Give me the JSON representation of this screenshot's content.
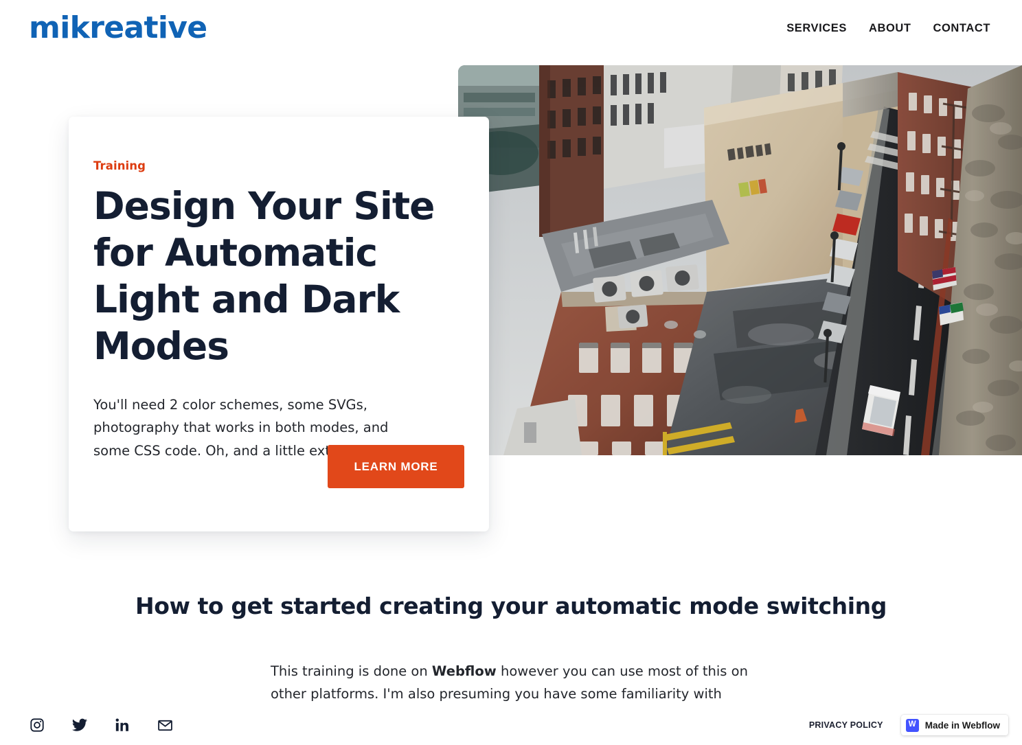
{
  "header": {
    "brand": "mikreative",
    "nav": [
      {
        "label": "SERVICES"
      },
      {
        "label": "ABOUT"
      },
      {
        "label": "CONTACT"
      }
    ]
  },
  "hero": {
    "eyebrow": "Training",
    "title": "Design Your Site for Automatic Light and Dark Modes",
    "body": "You'll need 2 color schemes, some SVGs, photography that works in both modes, and some CSS code. Oh, and a little extra time.",
    "cta_label": "LEARN MORE",
    "cta_color": "#e1481a",
    "eyebrow_color": "#dd3c10",
    "title_color": "#141e32",
    "image_alt": "Aerial view looking down a narrow city street with brick buildings, tar rooftops with HVAC units, graffiti, parked cars and a white car driving on the road"
  },
  "section": {
    "title": "How to get started creating your automatic mode switching",
    "paragraph_part1": "This training is done on ",
    "paragraph_bold": "Webflow",
    "paragraph_part2": " however you can use most of this on other platforms. I'm also presuming you have some familiarity with building in"
  },
  "footer": {
    "social": [
      {
        "name": "instagram-icon"
      },
      {
        "name": "twitter-icon"
      },
      {
        "name": "linkedin-icon"
      },
      {
        "name": "email-icon"
      }
    ],
    "privacy_label": "PRIVACY POLICY",
    "badge": {
      "mark": "W",
      "label": "Made in Webflow",
      "mark_color": "#4353ff"
    }
  }
}
